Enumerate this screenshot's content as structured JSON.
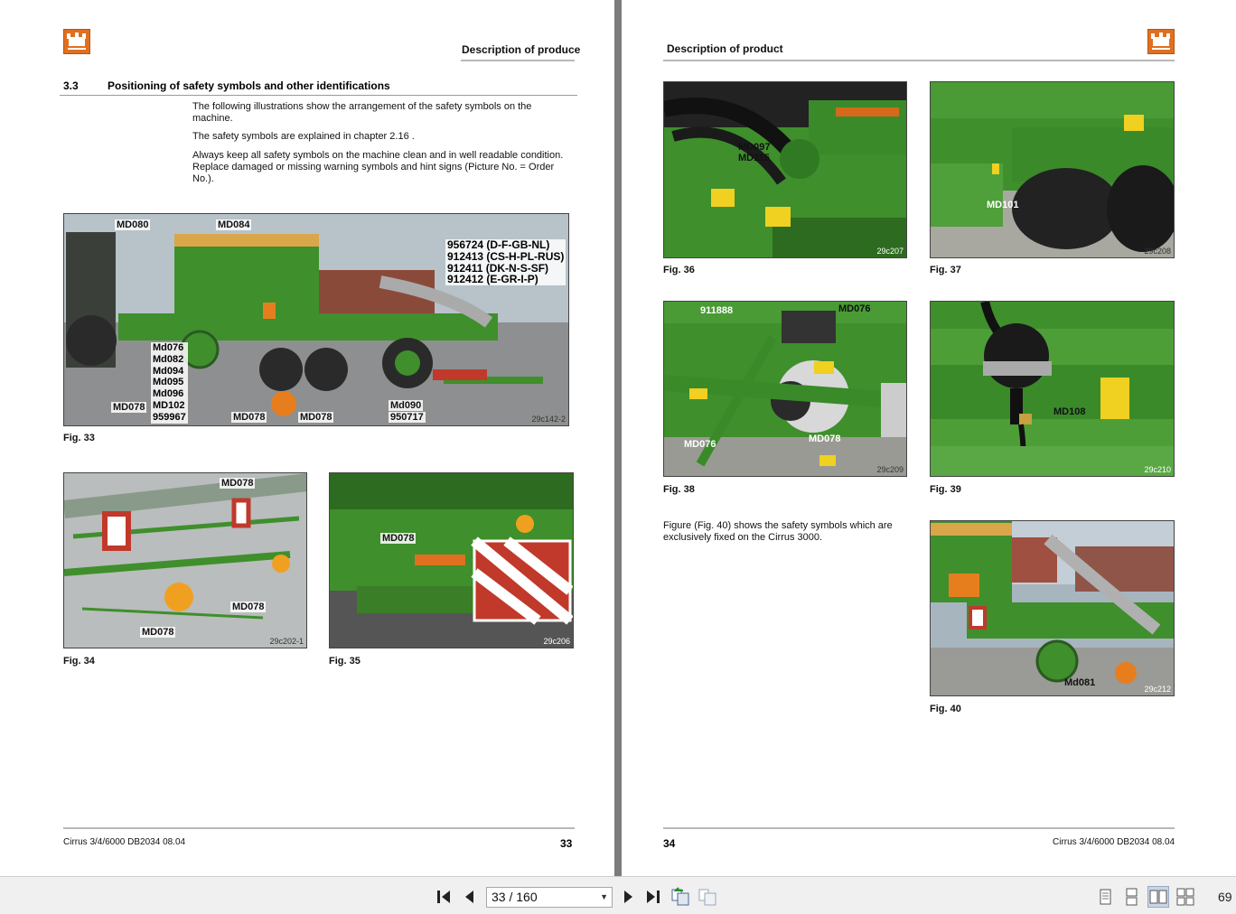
{
  "left_page": {
    "header_title": "Description of produce",
    "section_number": "3.3",
    "section_title": "Positioning of safety symbols and other identifications",
    "paragraphs": [
      "The following illustrations show the arrangement of the safety symbols on the machine.",
      "The safety symbols are explained in chapter 2.16 .",
      "Always keep all safety symbols on the machine clean and in well readable condition. Replace damaged or missing warning symbols and hint signs (Picture No. = Order No.)."
    ],
    "fig33": {
      "caption": "Fig. 33",
      "labels": {
        "md080": "MD080",
        "md084": "MD084",
        "order_list": [
          "956724 (D-F-GB-NL)",
          "912413 (CS-H-PL-RUS)",
          "912411 (DK-N-S-SF)",
          "912412 (E-GR-I-P)"
        ],
        "md_stack": [
          "Md076",
          "Md082",
          "Md094",
          "Md095",
          "Md096",
          "MD102",
          "959967"
        ],
        "md078_a": "MD078",
        "md078_b": "MD078",
        "md078_c": "MD078",
        "md090": "Md090",
        "n950717": "950717"
      },
      "image_id": "29c142-2"
    },
    "fig34": {
      "caption": "Fig. 34",
      "labels": [
        "MD078",
        "MD078",
        "MD078"
      ],
      "image_id": "29c202-1"
    },
    "fig35": {
      "caption": "Fig. 35",
      "labels": [
        "MD078"
      ],
      "image_id": "29c206"
    },
    "footer": "Cirrus 3/4/6000 DB2034 08.04",
    "page_number": "33"
  },
  "right_page": {
    "header_title": "Description of product",
    "fig36": {
      "caption": "Fig. 36",
      "labels": [
        "MD097",
        "MD115"
      ],
      "image_id": "29c207"
    },
    "fig37": {
      "caption": "Fig. 37",
      "labels": [
        "MD101"
      ],
      "image_id": "29c208"
    },
    "fig38": {
      "caption": "Fig. 38",
      "labels": [
        "911888",
        "MD076",
        "MD076",
        "MD078"
      ],
      "image_id": "29c209"
    },
    "fig39": {
      "caption": "Fig. 39",
      "labels": [
        "MD108"
      ],
      "image_id": "29c210"
    },
    "fig40_text": "Figure (Fig. 40) shows the safety symbols which are exclusively fixed on the Cirrus 3000.",
    "fig40": {
      "caption": "Fig. 40",
      "labels": [
        "Md081"
      ],
      "image_id": "29c212"
    },
    "footer": "Cirrus 3/4/6000 DB2034 08.04",
    "page_number": "34"
  },
  "toolbar": {
    "page_field": "33 / 160",
    "zoom": "69",
    "icons": [
      "first-page-icon",
      "previous-page-icon",
      "next-page-icon",
      "last-page-icon",
      "go-back-view-icon",
      "go-forward-view-icon",
      "single-page-view-icon",
      "continuous-view-icon",
      "two-page-view-icon",
      "two-page-continuous-view-icon"
    ]
  },
  "colors": {
    "brand_orange": "#e07020",
    "machine_green": "#3f8f2c",
    "page_bg": "#ffffff",
    "viewer_bg": "#8a8a8a"
  }
}
